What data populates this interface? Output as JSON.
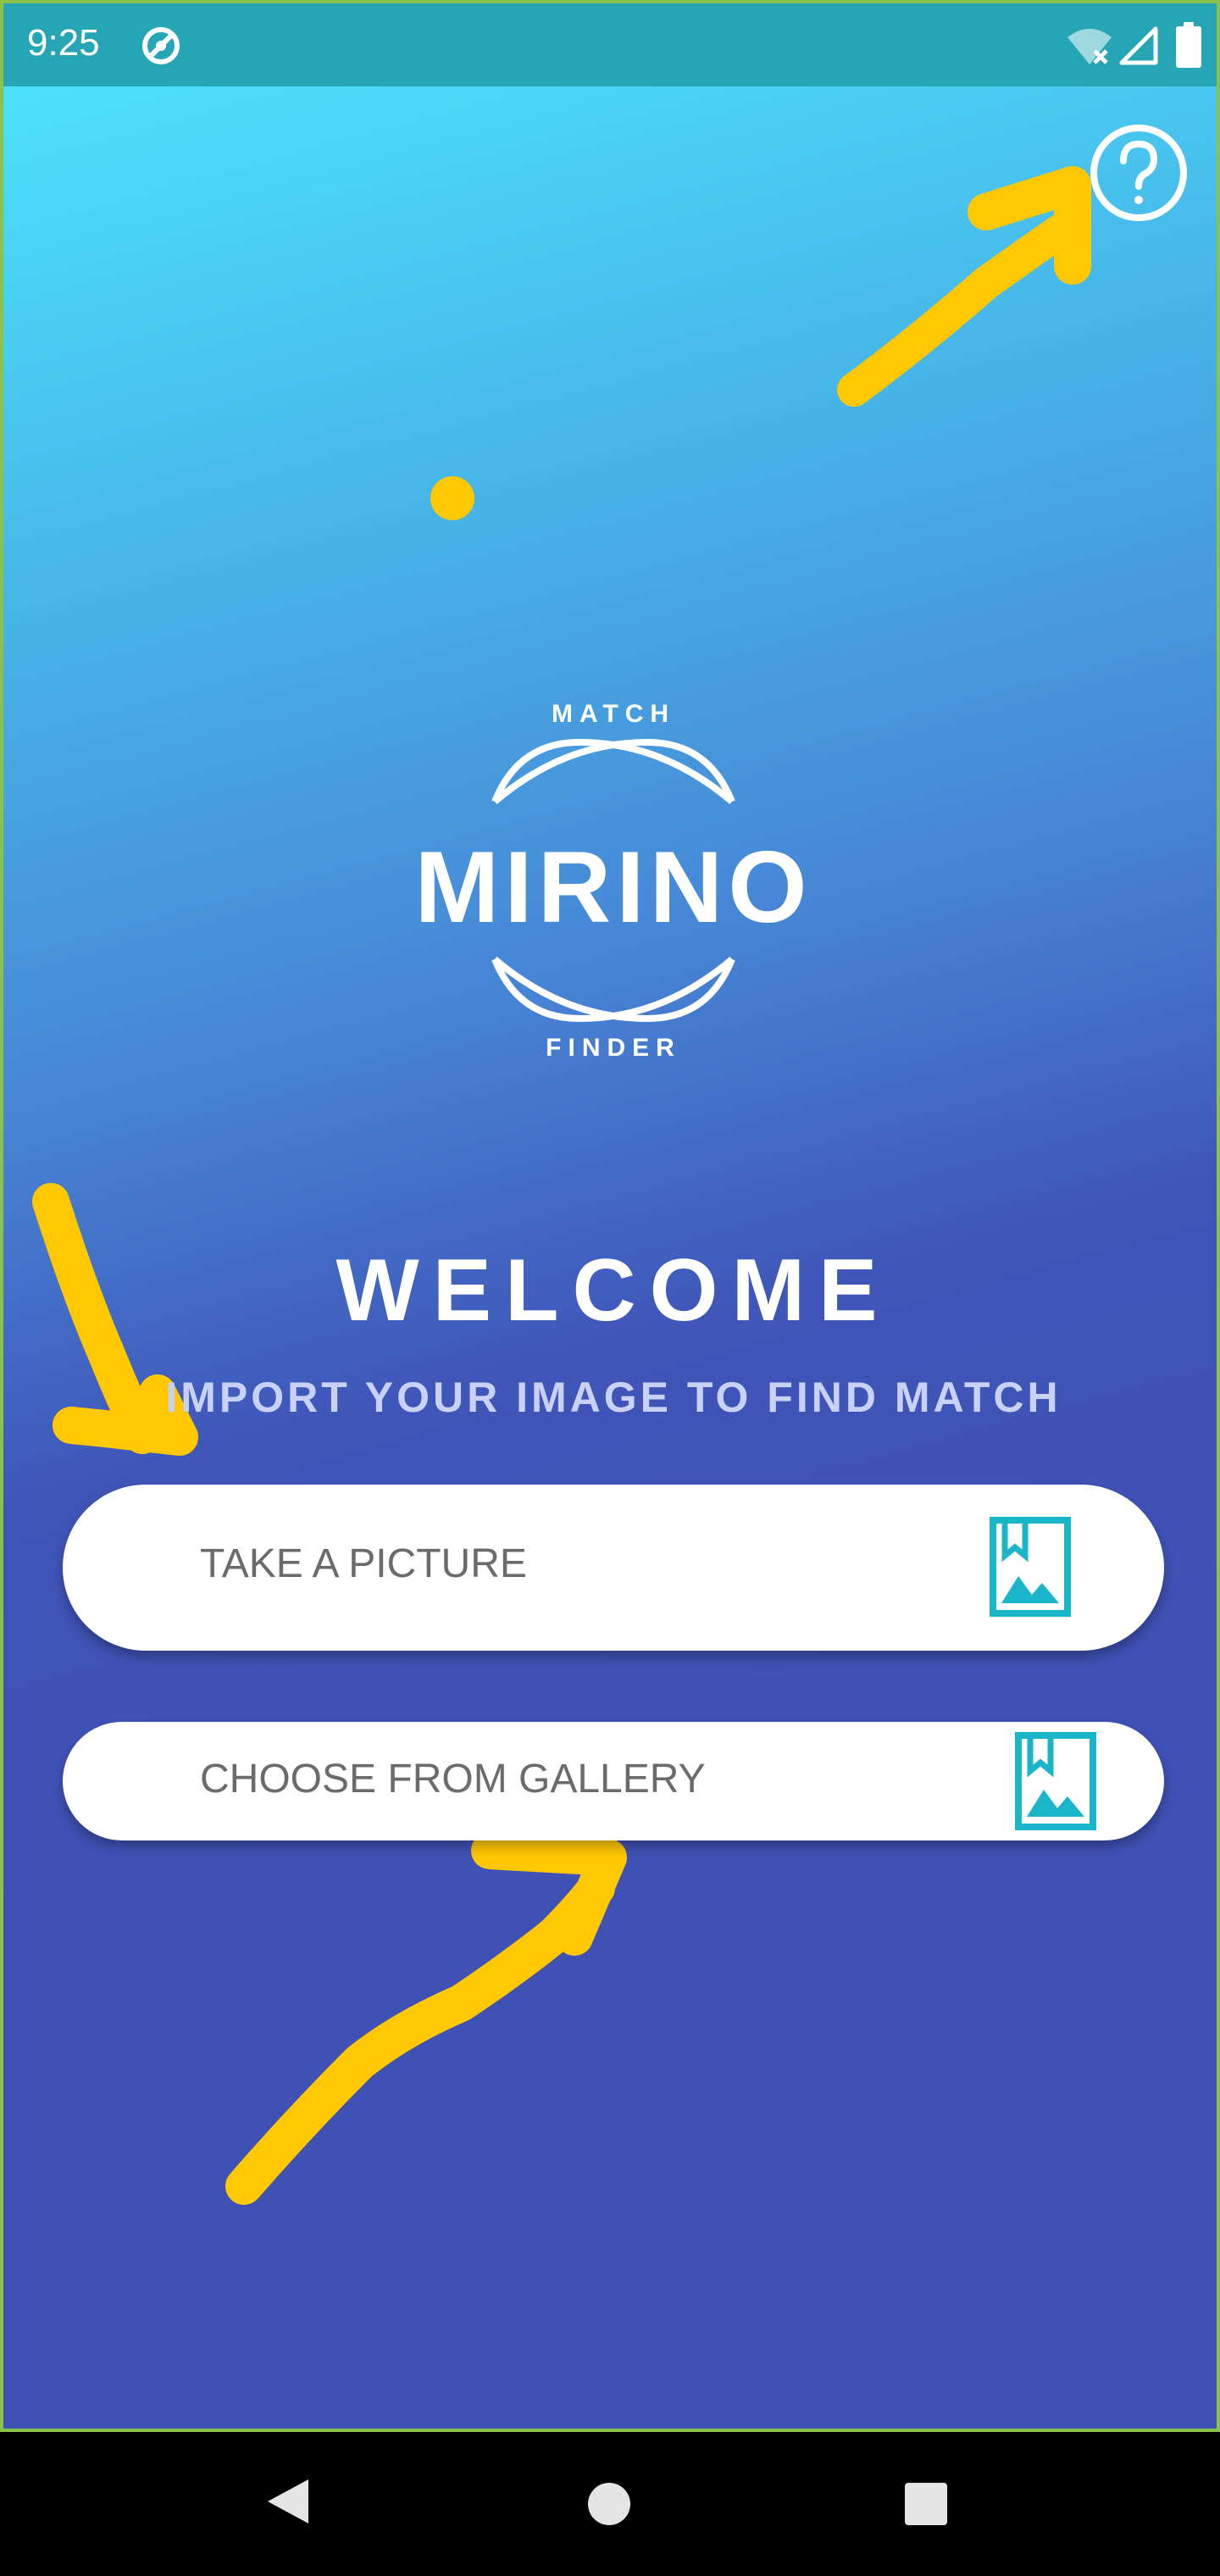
{
  "status_bar": {
    "time": "9:25",
    "icons": [
      "app-notification-icon",
      "wifi-off-icon",
      "cell-signal-icon",
      "battery-icon"
    ]
  },
  "header": {
    "help_icon": "help-circle-icon"
  },
  "logo": {
    "top_text": "MATCH",
    "name": "MIRINO",
    "bottom_text": "FINDER"
  },
  "welcome": {
    "title": "WELCOME",
    "subtitle": "IMPORT YOUR IMAGE TO FIND MATCH"
  },
  "actions": {
    "take_picture_label": "TAKE A PICTURE",
    "gallery_label": "CHOOSE FROM GALLERY",
    "icon": "bookmark-image-icon"
  },
  "nav_bar": {
    "icons": [
      "back-icon",
      "home-icon",
      "recents-icon"
    ]
  },
  "colors": {
    "gradient_top": "#4de8ff",
    "gradient_bottom": "#3f51b5",
    "status_bar": "#26a6b4",
    "button_icon": "#1bb5c9",
    "annotation": "#ffc800"
  }
}
